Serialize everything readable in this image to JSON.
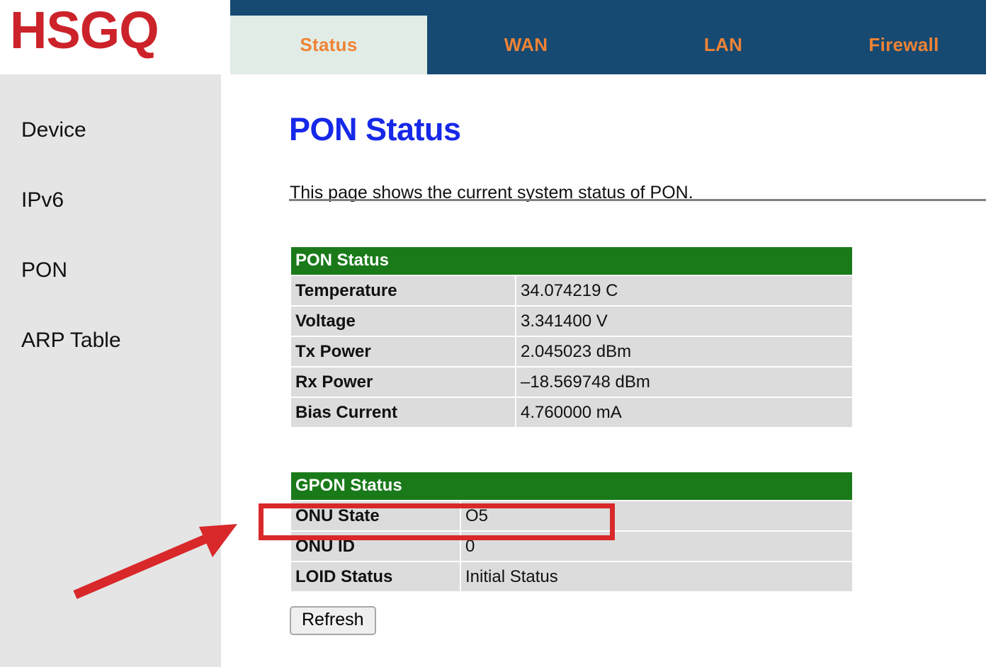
{
  "brand": {
    "logo_text": "HSGQ",
    "logo_color": "#cc2229"
  },
  "nav": {
    "background_color": "#164a72",
    "active_background_color": "#e1ece6",
    "text_color": "#ef8335",
    "tabs": [
      {
        "label": "Status",
        "active": true
      },
      {
        "label": "WAN",
        "active": false
      },
      {
        "label": "LAN",
        "active": false
      },
      {
        "label": "Firewall",
        "active": false
      }
    ]
  },
  "sidebar": {
    "background_color": "#e5e5e5",
    "items": [
      {
        "label": "Device"
      },
      {
        "label": "IPv6"
      },
      {
        "label": "PON"
      },
      {
        "label": "ARP Table"
      }
    ]
  },
  "main": {
    "title": "PON Status",
    "title_color": "#1628e8",
    "description": "This page shows the current system status of PON.",
    "refresh_label": "Refresh"
  },
  "tables": {
    "header_color": "#1a7a1a",
    "row_color": "#dcdcdc",
    "pon": {
      "header": "PON Status",
      "rows": [
        {
          "key": "Temperature",
          "value": "34.074219 C"
        },
        {
          "key": "Voltage",
          "value": "3.341400 V"
        },
        {
          "key": "Tx Power",
          "value": "2.045023 dBm"
        },
        {
          "key": "Rx Power",
          "value": "–18.569748 dBm"
        },
        {
          "key": "Bias Current",
          "value": "4.760000 mA"
        }
      ]
    },
    "gpon": {
      "header": "GPON Status",
      "rows": [
        {
          "key": "ONU State",
          "value": "O5"
        },
        {
          "key": "ONU ID",
          "value": "0"
        },
        {
          "key": "LOID Status",
          "value": "Initial Status"
        }
      ]
    }
  },
  "annotations": {
    "color": "#d8282a",
    "highlight_target": "ONU State",
    "arrow_points_to": "ONU State"
  }
}
